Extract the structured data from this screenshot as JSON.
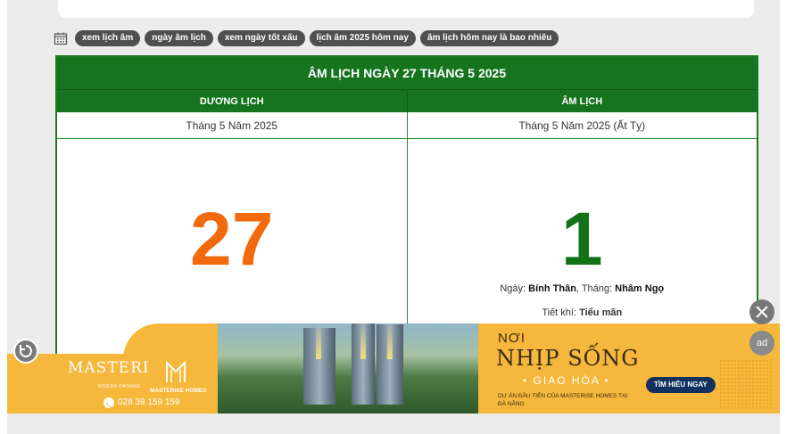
{
  "tags": [
    "xem lịch âm",
    "ngày âm lịch",
    "xem ngày tốt xấu",
    "lịch âm 2025 hôm nay",
    "âm lịch hôm nay là bao nhiêu"
  ],
  "calendar": {
    "title": "ÂM LỊCH NGÀY 27 THÁNG 5 2025",
    "solar_header": "DƯƠNG LỊCH",
    "lunar_header": "ÂM LỊCH",
    "solar_month": "Tháng 5 Năm 2025",
    "lunar_month": "Tháng 5 Năm 2025 (Ất Tỵ)",
    "solar_day": "27",
    "lunar_day": "1",
    "day_label": "Ngày: ",
    "day_value": "Bính Thân",
    "month_label": ", Tháng: ",
    "month_value": "Nhâm Ngọ",
    "term_label": "Tiết khí: ",
    "term_value": "Tiểu mãn"
  },
  "ad": {
    "brand": "MASTERI",
    "brand_sub": "RIVERA DANANG",
    "developer": "MASTERISE HOMES",
    "phone": "028 39 159 159",
    "headline_1": "NƠI",
    "headline_2": "NHỊP SỐNG",
    "headline_3": "• GIAO HÒA •",
    "description": "DỰ ÁN ĐẦU TIÊN CỦA MASTERISE HOMES TẠI ĐÀ NẴNG",
    "cta": "TÌM HIỂU NGAY",
    "badge": "ad"
  },
  "colors": {
    "green": "#16741e",
    "orange": "#f26a0e",
    "ad_yellow": "#f6b83c",
    "cta_navy": "#13305f"
  }
}
